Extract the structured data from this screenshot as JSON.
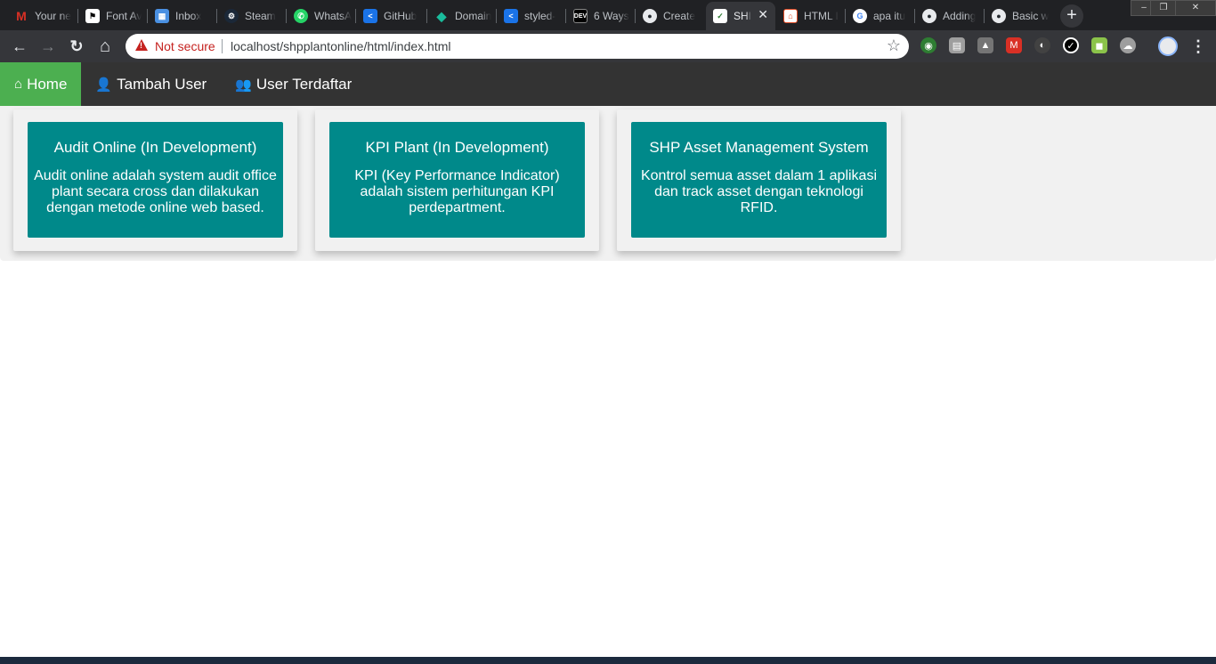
{
  "browser": {
    "tabs": [
      {
        "title": "Your ne",
        "icon": "gmail-icon",
        "color": "#d93025"
      },
      {
        "title": "Font Av",
        "icon": "flag-icon",
        "color": "#ffffff"
      },
      {
        "title": "Inbox",
        "icon": "inbox-icon",
        "color": "#4a90e2"
      },
      {
        "title": "Steam",
        "icon": "steam-icon",
        "color": "#1b2838"
      },
      {
        "title": "WhatsA",
        "icon": "whatsapp-icon",
        "color": "#25d366"
      },
      {
        "title": "GitHub",
        "icon": "code-share-icon",
        "color": "#1a73e8"
      },
      {
        "title": "Domain",
        "icon": "diamond-icon",
        "color": "#1abc9c"
      },
      {
        "title": "styled-",
        "icon": "code-share-icon",
        "color": "#1a73e8"
      },
      {
        "title": "6 Ways",
        "icon": "dev-icon",
        "color": "#000000"
      },
      {
        "title": "Create",
        "icon": "github-icon",
        "color": "#24292e"
      },
      {
        "title": "SHI",
        "icon": "leaf-icon",
        "color": "#ffffff"
      },
      {
        "title": "HTML I",
        "icon": "html-icon",
        "color": "#e34c26"
      },
      {
        "title": "apa itu",
        "icon": "google-icon",
        "color": "#ffffff"
      },
      {
        "title": "Adding",
        "icon": "github-icon",
        "color": "#24292e"
      },
      {
        "title": "Basic w",
        "icon": "github-icon",
        "color": "#24292e"
      }
    ],
    "dev_favicon_text": "DEV",
    "active_tab_index": 10,
    "close_glyph": "✕",
    "newtab_glyph": "+",
    "window_controls": [
      "‒",
      "❐",
      "✕"
    ],
    "address": {
      "security_label": "Not secure",
      "url": "localhost/shpplantonline/html/index.html"
    },
    "nav_glyphs": {
      "back": "←",
      "forward": "→",
      "reload": "↻",
      "home": "⌂",
      "star": "☆",
      "menu": "⋮"
    },
    "extensions": [
      {
        "name": "earth-extension-icon",
        "color": "#2e7d32"
      },
      {
        "name": "print-extension-icon",
        "color": "#9e9e9e"
      },
      {
        "name": "drive-extension-icon",
        "color": "#757575"
      },
      {
        "name": "gmail-extension-icon",
        "color": "#d93025"
      },
      {
        "name": "spy-extension-icon",
        "color": "#424242"
      },
      {
        "name": "checkmark-extension-icon",
        "color": "#000000"
      },
      {
        "name": "android-extension-icon",
        "color": "#8bc34a"
      },
      {
        "name": "cloud-extension-icon",
        "color": "#9e9e9e"
      }
    ]
  },
  "nav": {
    "home": {
      "label": "Home",
      "icon": "home-icon",
      "glyph": "⌂"
    },
    "add_user": {
      "label": "Tambah User",
      "icon": "user-plus-icon",
      "glyph": "👤"
    },
    "users": {
      "label": "User Terdaftar",
      "icon": "users-icon",
      "glyph": "👥"
    },
    "active_color": "#4caf50",
    "bar_color": "#333333"
  },
  "cards": [
    {
      "title": "Audit Online (In Development)",
      "text": "Audit online adalah system audit office plant secara cross dan dilakukan dengan metode online web based."
    },
    {
      "title": "KPI Plant (In Development)",
      "text": "KPI (Key Performance Indicator) adalah sistem perhitungan KPI perdepartment."
    },
    {
      "title": "SHP Asset Management System",
      "text": "Kontrol semua asset dalam 1 aplikasi dan track asset dengan teknologi RFID."
    }
  ],
  "card_color": "#00898a"
}
